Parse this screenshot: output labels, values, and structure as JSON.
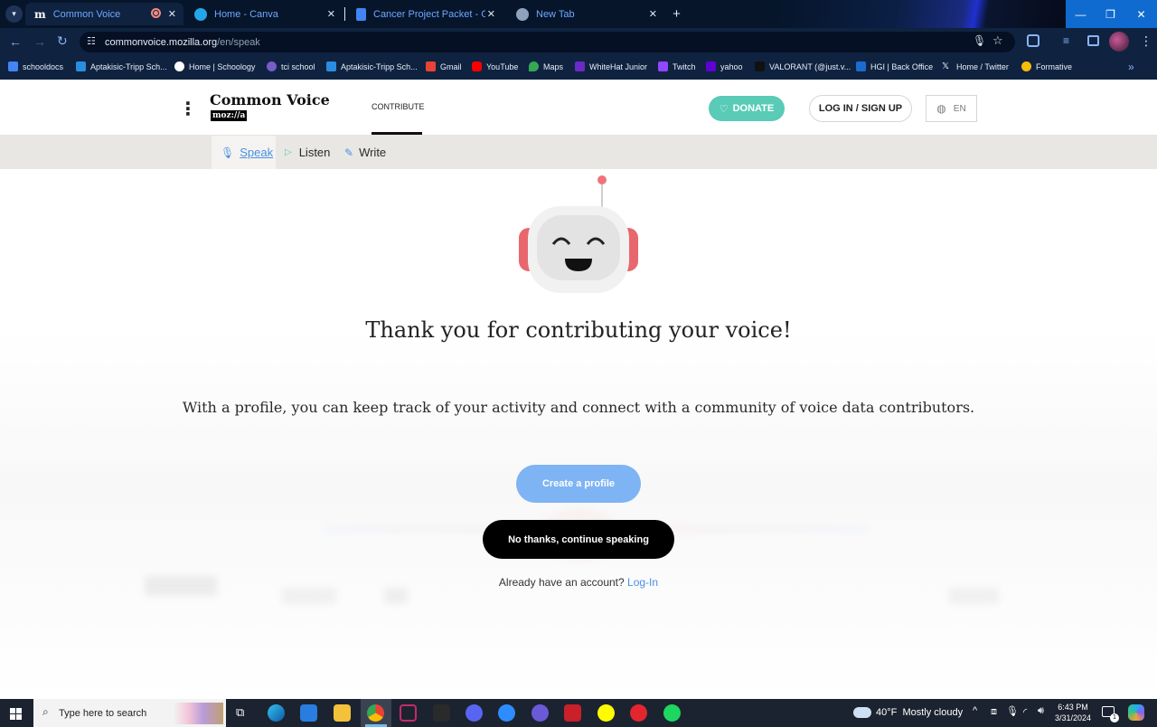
{
  "browser": {
    "tabs": [
      {
        "label": "Common Voice",
        "active": true
      },
      {
        "label": "Home - Canva",
        "active": false
      },
      {
        "label": "Cancer Project Packet - Google Docs",
        "active": false
      },
      {
        "label": "New Tab",
        "active": false
      }
    ],
    "url": {
      "host": "commonvoice.mozilla.org",
      "path": "/en/speak"
    },
    "bookmarks": [
      "schooldocs",
      "Aptakisic-Tripp Sch...",
      "Home | Schoology",
      "tci school",
      "Aptakisic-Tripp Sch...",
      "Gmail",
      "YouTube",
      "Maps",
      "WhiteHat Junior",
      "Twitch",
      "yahoo",
      "VALORANT (@just.v...",
      "HGI | Back Office",
      "Home / Twitter",
      "Formative"
    ]
  },
  "site": {
    "brand": "Common Voice",
    "brand_sub": "moz://a",
    "nav_contribute": "CONTRIBUTE",
    "donate_label": "DONATE",
    "login_label": "LOG IN / SIGN UP",
    "lang_label": "EN",
    "subnav": [
      "Speak",
      "Listen",
      "Write"
    ]
  },
  "modal": {
    "title": "Thank you for contributing your voice!",
    "body": "With a profile, you can keep track of your activity and connect with a community of voice data contributors.",
    "create_label": "Create a profile",
    "continue_label": "No thanks, continue speaking",
    "account_prompt": "Already have an account?",
    "login_link": "Log-In"
  },
  "taskbar": {
    "search_placeholder": "Type here to search",
    "weather": "40°F  Mostly cloudy",
    "time": "6:43 PM",
    "date": "3/31/2024",
    "notification_count": "1"
  },
  "colors": {
    "accent_blue": "#4a90e2",
    "donate_teal": "#59cbb7",
    "create_btn": "#7eb4f3"
  }
}
